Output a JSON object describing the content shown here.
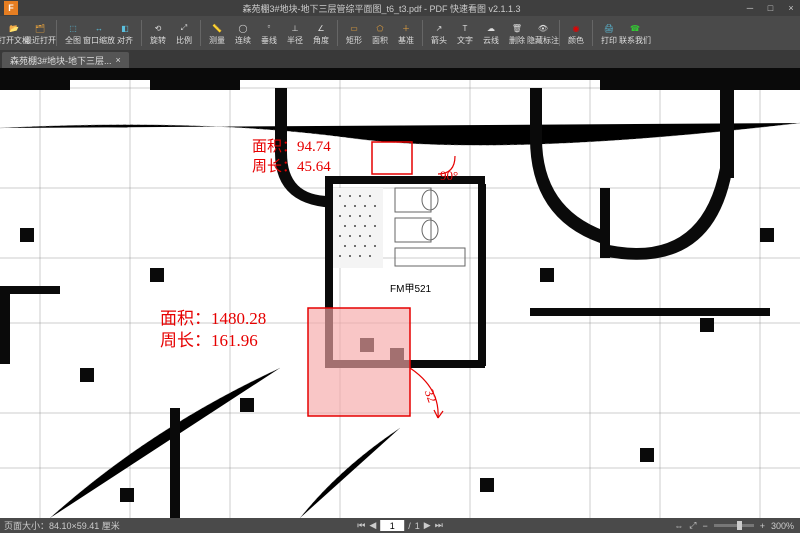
{
  "app": {
    "title": "森苑棚3#地块-地下三层管综平面图_t6_t3.pdf - PDF 快速看图 v2.1.1.3",
    "logo_letter": "F"
  },
  "toolbar": [
    {
      "icon": "📂",
      "label": "打开文档",
      "color": "#e8a33d"
    },
    {
      "icon": "🗂",
      "label": "最近打开",
      "color": "#e8a33d"
    },
    {
      "icon": "SEP"
    },
    {
      "icon": "⬚",
      "label": "全图",
      "color": "#5bc0de"
    },
    {
      "icon": "↔",
      "label": "窗口缩放",
      "color": "#5bc0de"
    },
    {
      "icon": "◧",
      "label": "对齐",
      "color": "#5bc0de"
    },
    {
      "icon": "SEP"
    },
    {
      "icon": "⟲",
      "label": "旋转",
      "color": "#ddd"
    },
    {
      "icon": "⤢",
      "label": "比例",
      "color": "#ddd"
    },
    {
      "icon": "SEP"
    },
    {
      "icon": "📏",
      "label": "测量",
      "color": "#ddd"
    },
    {
      "icon": "◯",
      "label": "连续",
      "color": "#ddd"
    },
    {
      "icon": "⏒",
      "label": "垂线",
      "color": "#ddd"
    },
    {
      "icon": "⊥",
      "label": "半径",
      "color": "#ddd"
    },
    {
      "icon": "∠",
      "label": "角度",
      "color": "#ddd"
    },
    {
      "icon": "SEP"
    },
    {
      "icon": "▭",
      "label": "矩形",
      "color": "#e8a33d"
    },
    {
      "icon": "⬠",
      "label": "面积",
      "color": "#e8a33d"
    },
    {
      "icon": "＋",
      "label": "基准",
      "color": "#e8a33d"
    },
    {
      "icon": "SEP"
    },
    {
      "icon": "↗",
      "label": "箭头",
      "color": "#ddd"
    },
    {
      "icon": "T",
      "label": "文字",
      "color": "#ddd"
    },
    {
      "icon": "☁",
      "label": "云线",
      "color": "#ddd"
    },
    {
      "icon": "🗑",
      "label": "删除",
      "color": "#ddd"
    },
    {
      "icon": "👁",
      "label": "隐藏标注",
      "color": "#ddd"
    },
    {
      "icon": "SEP"
    },
    {
      "icon": "◉",
      "label": "颜色",
      "color": "#e60000"
    },
    {
      "icon": "SEP"
    },
    {
      "icon": "🖨",
      "label": "打印",
      "color": "#5bc0de"
    },
    {
      "icon": "☎",
      "label": "联系我们",
      "color": "#3c3"
    }
  ],
  "tab": {
    "label": "森苑棚3#地块-地下三层...",
    "close": "×"
  },
  "measurements": {
    "m1": {
      "area_label": "面积：",
      "area_val": "94.74",
      "perim_label": "周长：",
      "perim_val": "45.64"
    },
    "m2": {
      "area_label": "面积：",
      "area_val": "1480.28",
      "perim_label": "周长：",
      "perim_val": "161.96"
    },
    "angle1": "90°",
    "dist1": "32"
  },
  "room": {
    "label": "FM甲521"
  },
  "status": {
    "pagesize": "页面大小：84.10×59.41 厘米",
    "page_current": "1",
    "page_sep": "/",
    "page_total": "1",
    "zoom": "300%",
    "zoom_pos_pct": 62
  },
  "window_controls": {
    "min": "─",
    "max": "□",
    "close": "×"
  }
}
